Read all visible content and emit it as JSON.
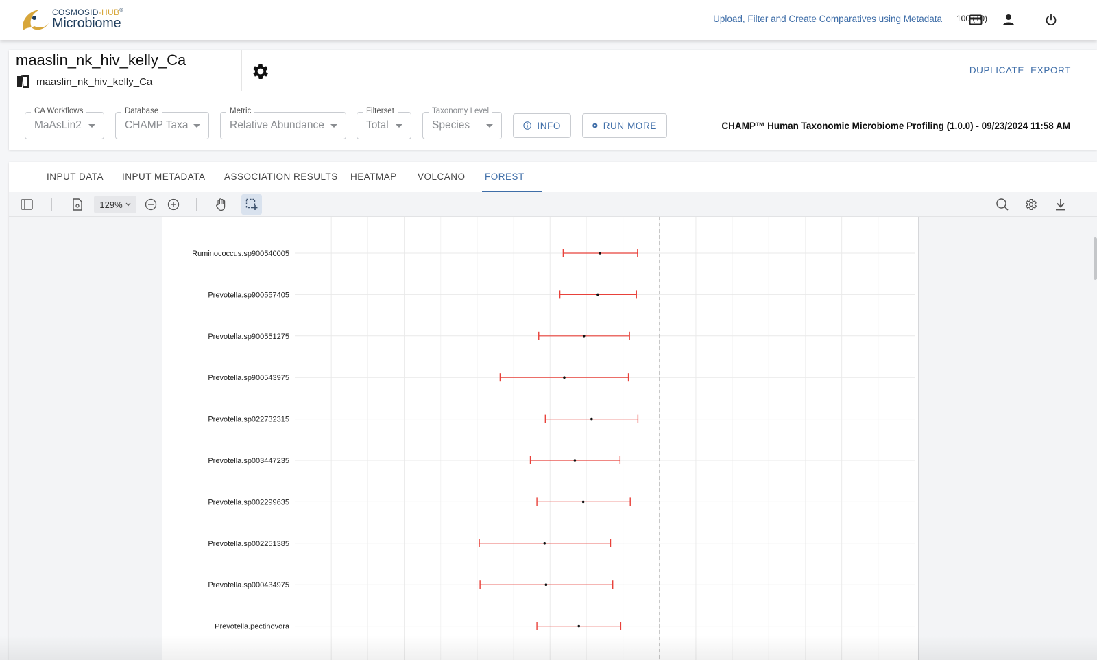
{
  "topbar": {
    "logo_top": "COSMOSID",
    "logo_hub": "-HUB",
    "logo_reg": "®",
    "logo_bottom": "Microbiome",
    "metadata_link": "Upload, Filter and Create Comparatives using Metadata",
    "credits": "100 (+0)",
    "icons": [
      "credit-card-icon",
      "user-icon",
      "power-icon"
    ]
  },
  "header": {
    "title": "maaslin_nk_hiv_kelly_Ca",
    "subtitle": "maaslin_nk_hiv_kelly_Ca",
    "duplicate_label": "DUPLICATE",
    "export_label": "EXPORT",
    "fields": [
      {
        "label": "CA Workflows",
        "value": "MaAsLin2"
      },
      {
        "label": "Database",
        "value": "CHAMP Taxa"
      },
      {
        "label": "Metric",
        "value": "Relative Abundance"
      },
      {
        "label": "Filterset",
        "value": "Total"
      },
      {
        "label": "Taxonomy Level",
        "value": "Species"
      }
    ],
    "info_label": "INFO",
    "run_more_label": "RUN MORE",
    "profile_info": "CHAMP™ Human Taxonomic Microbiome Profiling (1.0.0) - 09/23/2024 11:58 AM"
  },
  "tabs": [
    "INPUT DATA",
    "INPUT METADATA",
    "ASSOCIATION RESULTS",
    "HEATMAP",
    "VOLCANO",
    "FOREST"
  ],
  "active_tab": "FOREST",
  "viewer": {
    "zoom": "129%"
  },
  "chart_data": {
    "type": "forest",
    "xlim": [
      -1.0,
      0.7
    ],
    "reference_line": 0,
    "colors": {
      "interval": "#e8413a",
      "point": "#111111",
      "reference": "#b5b5b5"
    },
    "rows": [
      {
        "label": "Ruminococcus.sp900540005",
        "estimate": -0.163,
        "low": -0.264,
        "high": -0.06
      },
      {
        "label": "Prevotella.sp900557405",
        "estimate": -0.169,
        "low": -0.273,
        "high": -0.063
      },
      {
        "label": "Prevotella.sp900551275",
        "estimate": -0.207,
        "low": -0.331,
        "high": -0.082
      },
      {
        "label": "Prevotella.sp900543975",
        "estimate": -0.261,
        "low": -0.437,
        "high": -0.085
      },
      {
        "label": "Prevotella.sp022732315",
        "estimate": -0.186,
        "low": -0.313,
        "high": -0.059
      },
      {
        "label": "Prevotella.sp003447235",
        "estimate": -0.232,
        "low": -0.354,
        "high": -0.108
      },
      {
        "label": "Prevotella.sp002299635",
        "estimate": -0.209,
        "low": -0.336,
        "high": -0.08
      },
      {
        "label": "Prevotella.sp002251385",
        "estimate": -0.315,
        "low": -0.494,
        "high": -0.134
      },
      {
        "label": "Prevotella.sp000434975",
        "estimate": -0.311,
        "low": -0.492,
        "high": -0.128
      },
      {
        "label": "Prevotella.pectinovora",
        "estimate": -0.221,
        "low": -0.336,
        "high": -0.106
      }
    ]
  }
}
